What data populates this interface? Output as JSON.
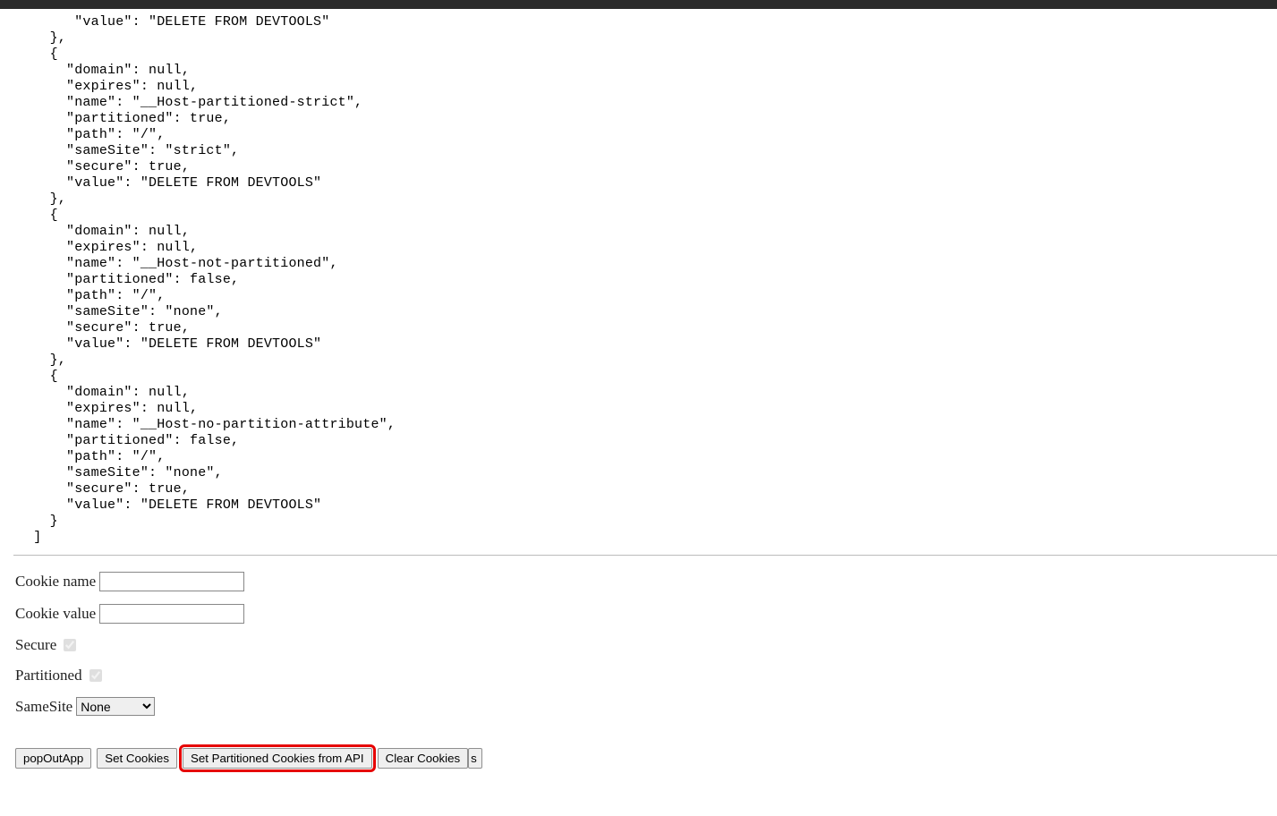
{
  "json_output": "      \"value\": \"DELETE FROM DEVTOOLS\"\n   },\n   {\n     \"domain\": null,\n     \"expires\": null,\n     \"name\": \"__Host-partitioned-strict\",\n     \"partitioned\": true,\n     \"path\": \"/\",\n     \"sameSite\": \"strict\",\n     \"secure\": true,\n     \"value\": \"DELETE FROM DEVTOOLS\"\n   },\n   {\n     \"domain\": null,\n     \"expires\": null,\n     \"name\": \"__Host-not-partitioned\",\n     \"partitioned\": false,\n     \"path\": \"/\",\n     \"sameSite\": \"none\",\n     \"secure\": true,\n     \"value\": \"DELETE FROM DEVTOOLS\"\n   },\n   {\n     \"domain\": null,\n     \"expires\": null,\n     \"name\": \"__Host-no-partition-attribute\",\n     \"partitioned\": false,\n     \"path\": \"/\",\n     \"sameSite\": \"none\",\n     \"secure\": true,\n     \"value\": \"DELETE FROM DEVTOOLS\"\n   }\n ]",
  "form": {
    "cookie_name_label": "Cookie name",
    "cookie_name_value": "",
    "cookie_value_label": "Cookie value",
    "cookie_value_value": "",
    "secure_label": "Secure",
    "partitioned_label": "Partitioned",
    "samesite_label": "SameSite",
    "samesite_selected": "None"
  },
  "buttons": {
    "popout": "popOutApp",
    "set_cookies": "Set  Cookies",
    "set_partitioned": "Set Partitioned Cookies from API",
    "clear_cookies": "Clear Cookies",
    "fragment": "s"
  }
}
